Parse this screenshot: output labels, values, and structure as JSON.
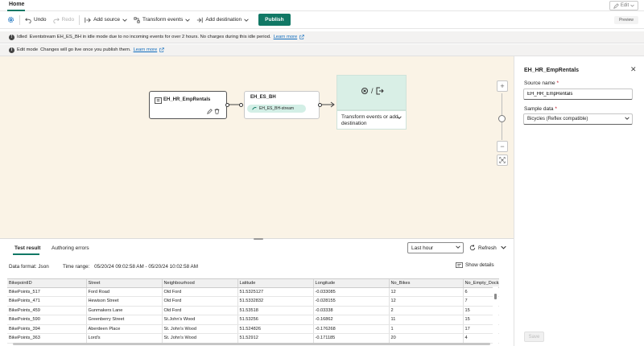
{
  "header": {
    "home_tab": "Home",
    "edit_label": "Edit",
    "preview_label": "Preview"
  },
  "toolbar": {
    "undo": "Undo",
    "redo": "Redo",
    "add_source": "Add source",
    "transform_events": "Transform events",
    "add_destination": "Add destination",
    "publish": "Publish"
  },
  "banners": {
    "idle_status": "Idled",
    "idle_text": "Eventstream EH_ES_BH in idle mode due to no incoming events for over 2 hours. No charges during this idle period.",
    "idle_link": "Learn more",
    "edit_status": "Edit mode",
    "edit_text": "Changes will go live once you publish them.",
    "edit_link": "Learn more"
  },
  "canvas": {
    "source_node": "EH_HR_EmpRentals",
    "eventstream_node": "EH_ES_BH",
    "eventstream_pill": "EH_ES_BH-stream",
    "dest_separator": "/",
    "dest_label": "Transform events or add destination"
  },
  "panel": {
    "title": "EH_HR_EmpRentals",
    "source_name_label": "Source name",
    "source_name_value": "EH_HR_EmpRentals",
    "sample_label": "Sample data",
    "sample_value": "Bicycles (Reflex compatible)",
    "required_mark": "*",
    "save": "Save"
  },
  "bottom": {
    "tab_test": "Test result",
    "tab_errors": "Authoring errors",
    "range": "Last hour",
    "refresh": "Refresh",
    "format_label": "Data format:",
    "format_value": "Json",
    "time_label": "Time range:",
    "time_value": "05/20/24 09:02:58 AM - 05/20/24 10:02:58 AM",
    "show_details": "Show details"
  },
  "table": {
    "columns": [
      "BikepointID",
      "Street",
      "Neighbourhood",
      "Latitude",
      "Longitude",
      "No_Bikes",
      "No_Empty_Docks"
    ],
    "rows": [
      [
        "BikePoints_517",
        "Ford Road",
        "Old Ford",
        "51.5325127",
        "-0.033085",
        "12",
        "6"
      ],
      [
        "BikePoints_471",
        "Hewison Street",
        "Old Ford",
        "51.5332832",
        "-0.028155",
        "12",
        "7"
      ],
      [
        "BikePoints_459",
        "Gunmakers Lane",
        "Old Ford",
        "51.53518",
        "-0.03338",
        "2",
        "15"
      ],
      [
        "BikePoints_590",
        "Greenberry Street",
        "St.John's Wood",
        "51.53256",
        "-0.16862",
        "11",
        "15"
      ],
      [
        "BikePoints_394",
        "Aberdeen Place",
        "St. John's Wood",
        "51.524826",
        "-0.176268",
        "1",
        "17"
      ],
      [
        "BikePoints_363",
        "Lord's",
        "St. John's Wood",
        "51.52912",
        "-0.171185",
        "20",
        "4"
      ]
    ]
  }
}
